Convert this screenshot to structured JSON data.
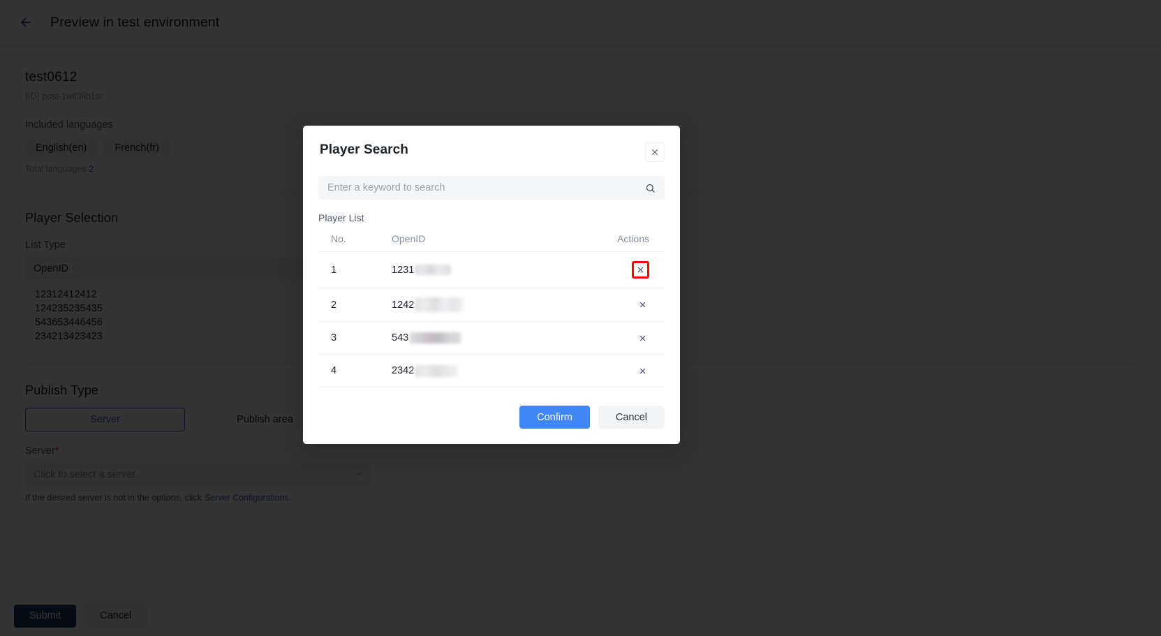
{
  "topbar": {
    "back_icon": "arrow-left-icon",
    "title": "Preview in test environment"
  },
  "page": {
    "post_title": "test0612",
    "post_id_tag": "[ID]",
    "post_id_value": "post-1wlf3iib1sr",
    "included_languages_label": "Included languages",
    "languages": [
      "English(en)",
      "French(fr)"
    ],
    "total_languages_label": "Total languages",
    "total_languages_count": "2",
    "player_selection_title": "Player Selection",
    "list_type_label": "List Type",
    "list_type_value": "OpenID",
    "openid_lines": [
      "12312412412",
      "124235235435",
      "543653446456",
      "234213423423"
    ],
    "publish_type_title": "Publish Type",
    "publish_tabs": [
      {
        "label": "Server",
        "active": true
      },
      {
        "label": "Publish area",
        "active": false
      }
    ],
    "server_label": "Server",
    "server_required_mark": "*",
    "server_placeholder": "Click to select a server",
    "server_caret_icon": "chevron-down-icon",
    "server_hint_prefix": "If the desired server is not in the options, click",
    "server_hint_link": "Server Configurations."
  },
  "bottombar": {
    "submit_label": "Submit",
    "cancel_label": "Cancel"
  },
  "modal": {
    "title": "Player Search",
    "close_icon": "close-icon",
    "search": {
      "placeholder": "Enter a keyword to search",
      "value": "",
      "icon": "search-icon"
    },
    "list_label": "Player List",
    "columns": [
      "No.",
      "OpenID",
      "Actions"
    ],
    "rows": [
      {
        "no": "1",
        "openid_visible": "1231",
        "mask_variant": "v1",
        "mask_width": 52,
        "action_icon": "close-icon",
        "highlighted": true
      },
      {
        "no": "2",
        "openid_visible": "1242",
        "mask_variant": "v2",
        "mask_width": 70,
        "action_icon": "close-icon",
        "highlighted": false
      },
      {
        "no": "3",
        "openid_visible": "543",
        "mask_variant": "v3",
        "mask_width": 74,
        "action_icon": "close-icon",
        "highlighted": false
      },
      {
        "no": "4",
        "openid_visible": "2342",
        "mask_variant": "v4",
        "mask_width": 62,
        "action_icon": "close-icon",
        "highlighted": false
      }
    ],
    "confirm_label": "Confirm",
    "cancel_label": "Cancel"
  },
  "colors": {
    "accent_blue": "#4086f4",
    "link_blue": "#3b63b8",
    "submit_dark": "#1b3a6b",
    "highlight_red": "#ff0000",
    "text_primary": "#1d2129",
    "text_muted": "#86909c"
  }
}
